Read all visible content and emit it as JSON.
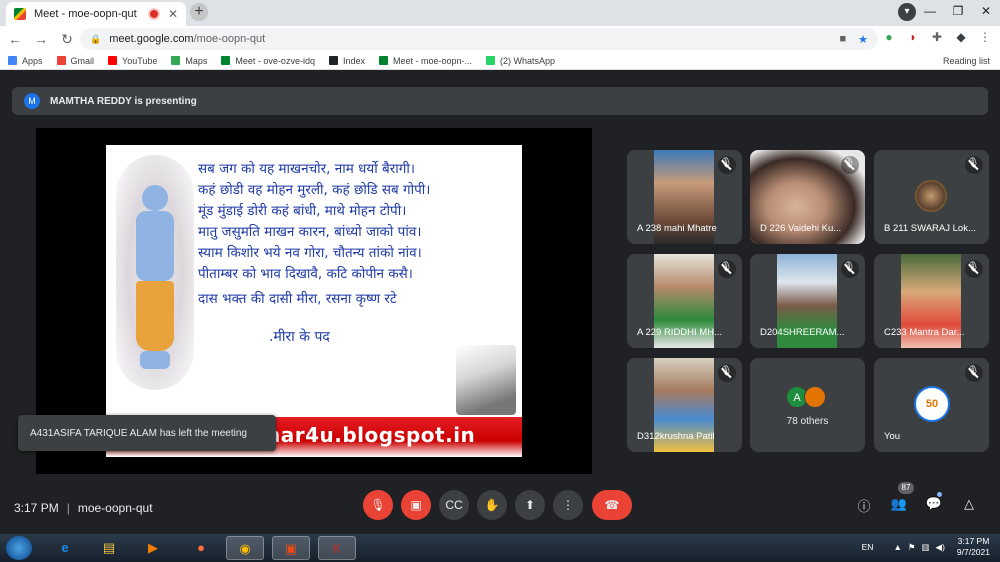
{
  "browser": {
    "tab": {
      "title": "Meet - moe-oopn-qut"
    },
    "url": {
      "host": "meet.google.com",
      "path": "/moe-oopn-qut"
    },
    "bookmarks": [
      {
        "label": "Apps",
        "color": "#4285f4"
      },
      {
        "label": "Gmail",
        "color": "#ea4335"
      },
      {
        "label": "YouTube",
        "color": "#ff0000"
      },
      {
        "label": "Maps",
        "color": "#34a853"
      },
      {
        "label": "Meet - ove-ozve-idq",
        "color": "#00832d"
      },
      {
        "label": "Index",
        "color": "#202124"
      },
      {
        "label": "Meet - moe-oopn-...",
        "color": "#00832d"
      },
      {
        "label": "(2) WhatsApp",
        "color": "#25d366"
      }
    ],
    "reading_list": "Reading list"
  },
  "meet": {
    "presenter": {
      "initial": "M",
      "text": "MAMTHA REDDY is presenting"
    },
    "slide": {
      "poem": [
        "सब जग को यह माखनचोर, नाम धर्यो बैरागी।",
        "कहं छोडी वह मोहन मुरली, कहं छोडि सब गोपी।",
        "मूंड मुंडाई डोरी कहं बांधी, माथे मोहन टोपी।",
        "मातु जसुमति माखन कारन, बांध्यो जाको पांव।",
        "स्याम किशोर भये नव गोरा, चौतन्य तांको नांव।",
        "पीताम्बर को भाव दिखावै, कटि कोपीन कसै।",
        "दास भक्त की दासी मीरा, रसना कृष्ण रटे"
      ],
      "label": ".मीरा के पद",
      "blog": "har4u.blogspot.in"
    },
    "toast": "A431ASIFA TARIQUE ALAM has left the meeting",
    "participants": [
      {
        "name": "A 238 mahi Mhatre"
      },
      {
        "name": "D 226 Vaidehi Ku..."
      },
      {
        "name": "B 211 SWARAJ Lok..."
      },
      {
        "name": "A 229 RIDDHI MH..."
      },
      {
        "name": "D204SHREERAM..."
      },
      {
        "name": "C233 Mantra Dar..."
      },
      {
        "name": "D312krushna Patil"
      }
    ],
    "others": {
      "initial": "A",
      "label": "78 others"
    },
    "you": {
      "label": "You",
      "badge": "50"
    },
    "time": "3:17 PM",
    "code": "moe-oopn-qut",
    "participant_count": "87"
  },
  "taskbar": {
    "lang": "EN",
    "time": "3:17 PM",
    "date": "9/7/2021"
  }
}
